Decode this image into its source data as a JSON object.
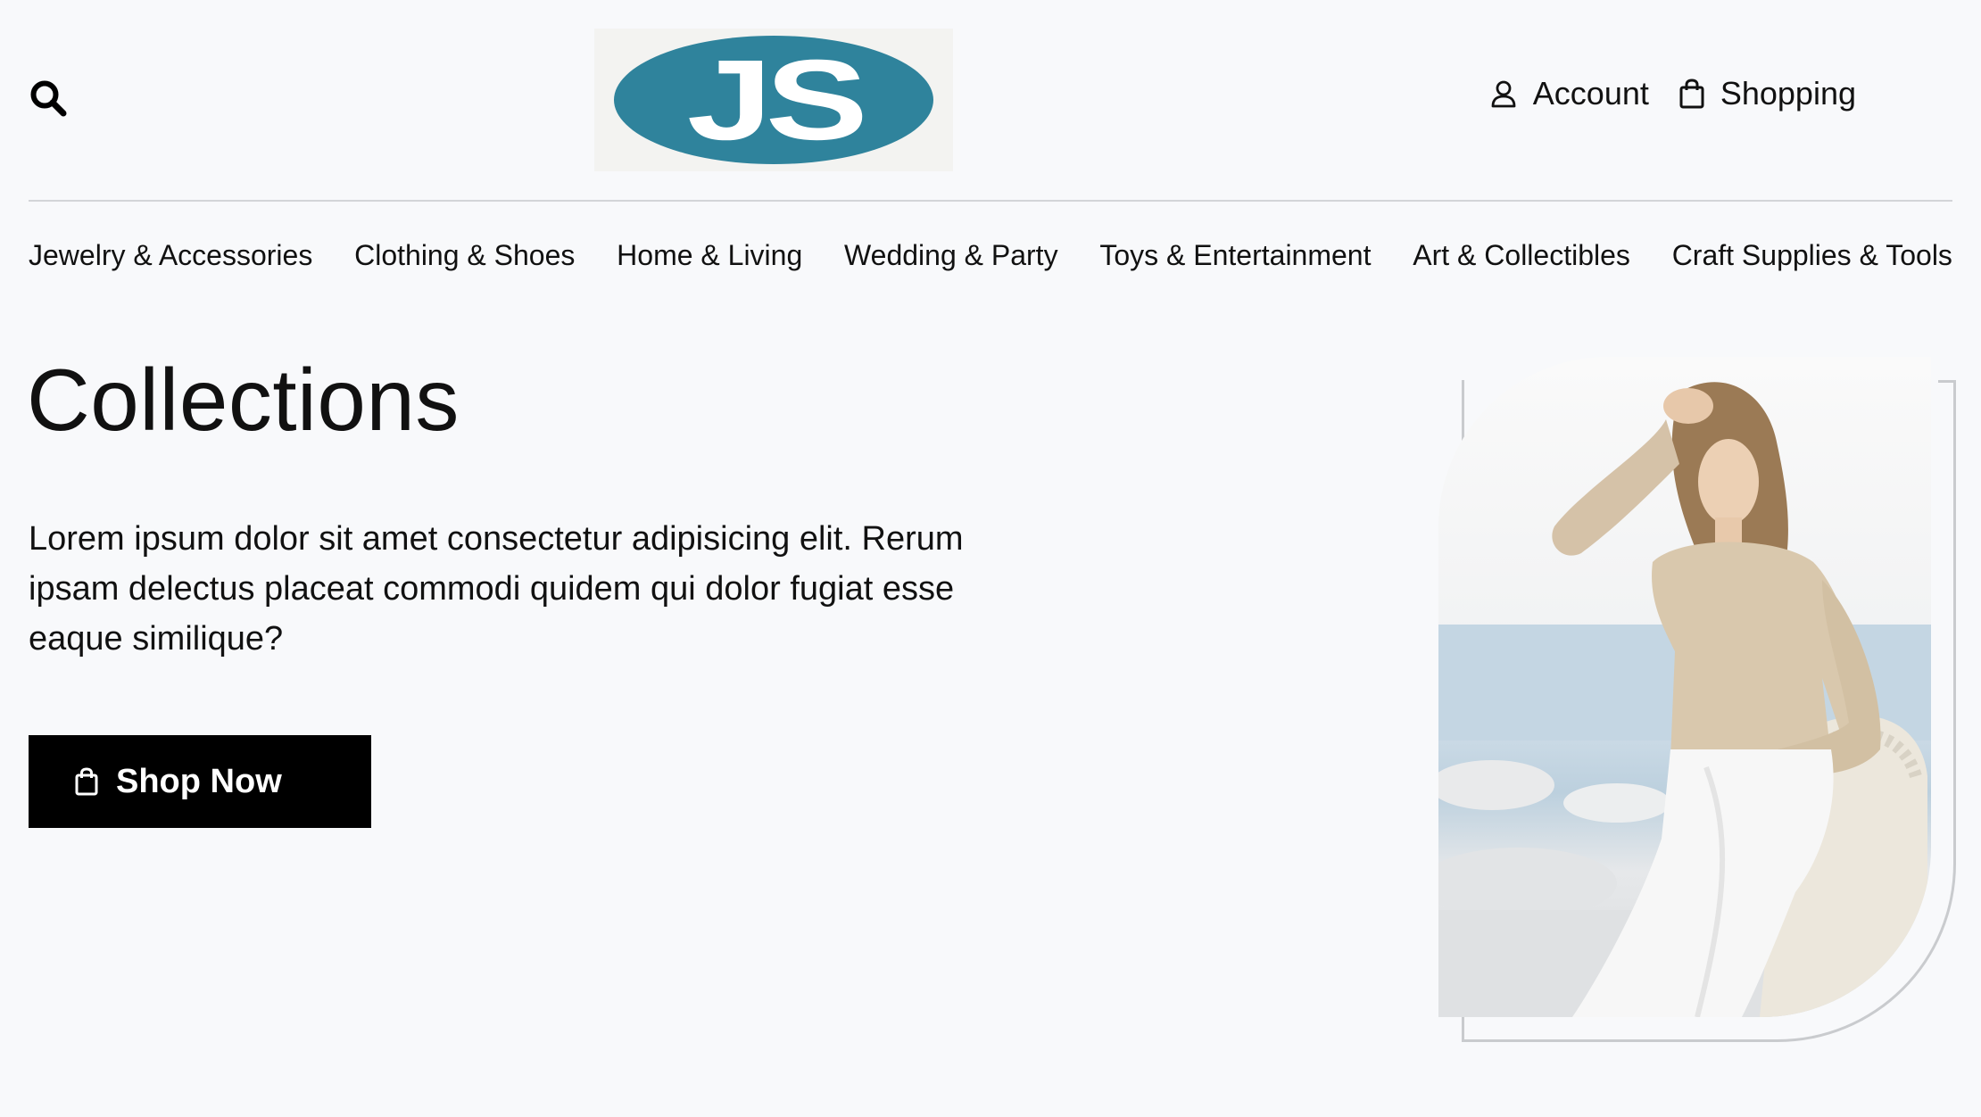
{
  "header": {
    "logo_text": "JS",
    "account_label": "Account",
    "shopping_label": "Shopping",
    "icons": {
      "search": "search-icon",
      "account": "user-icon",
      "shopping": "shopping-bag-icon"
    },
    "colors": {
      "logo_bg": "#2f839c",
      "divider": "#d3d5d8"
    }
  },
  "nav": {
    "items": [
      {
        "label": "Jewelry & Accessories"
      },
      {
        "label": "Clothing & Shoes"
      },
      {
        "label": "Home & Living"
      },
      {
        "label": "Wedding & Party"
      },
      {
        "label": "Toys & Entertainment"
      },
      {
        "label": "Art & Collectibles"
      },
      {
        "label": "Craft Supplies & Tools"
      }
    ]
  },
  "hero": {
    "title": "Collections",
    "text": "Lorem ipsum dolor sit amet consectetur adipisicing elit. Rerum ipsam delectus placeat commodi quidem qui dolor fugiat esse eaque similique?",
    "cta_label": "Shop Now",
    "cta_icon": "shopping-bag-icon",
    "cta_bg": "#000000"
  },
  "theme": {
    "background": "#f8f9fb",
    "text": "#111111"
  }
}
